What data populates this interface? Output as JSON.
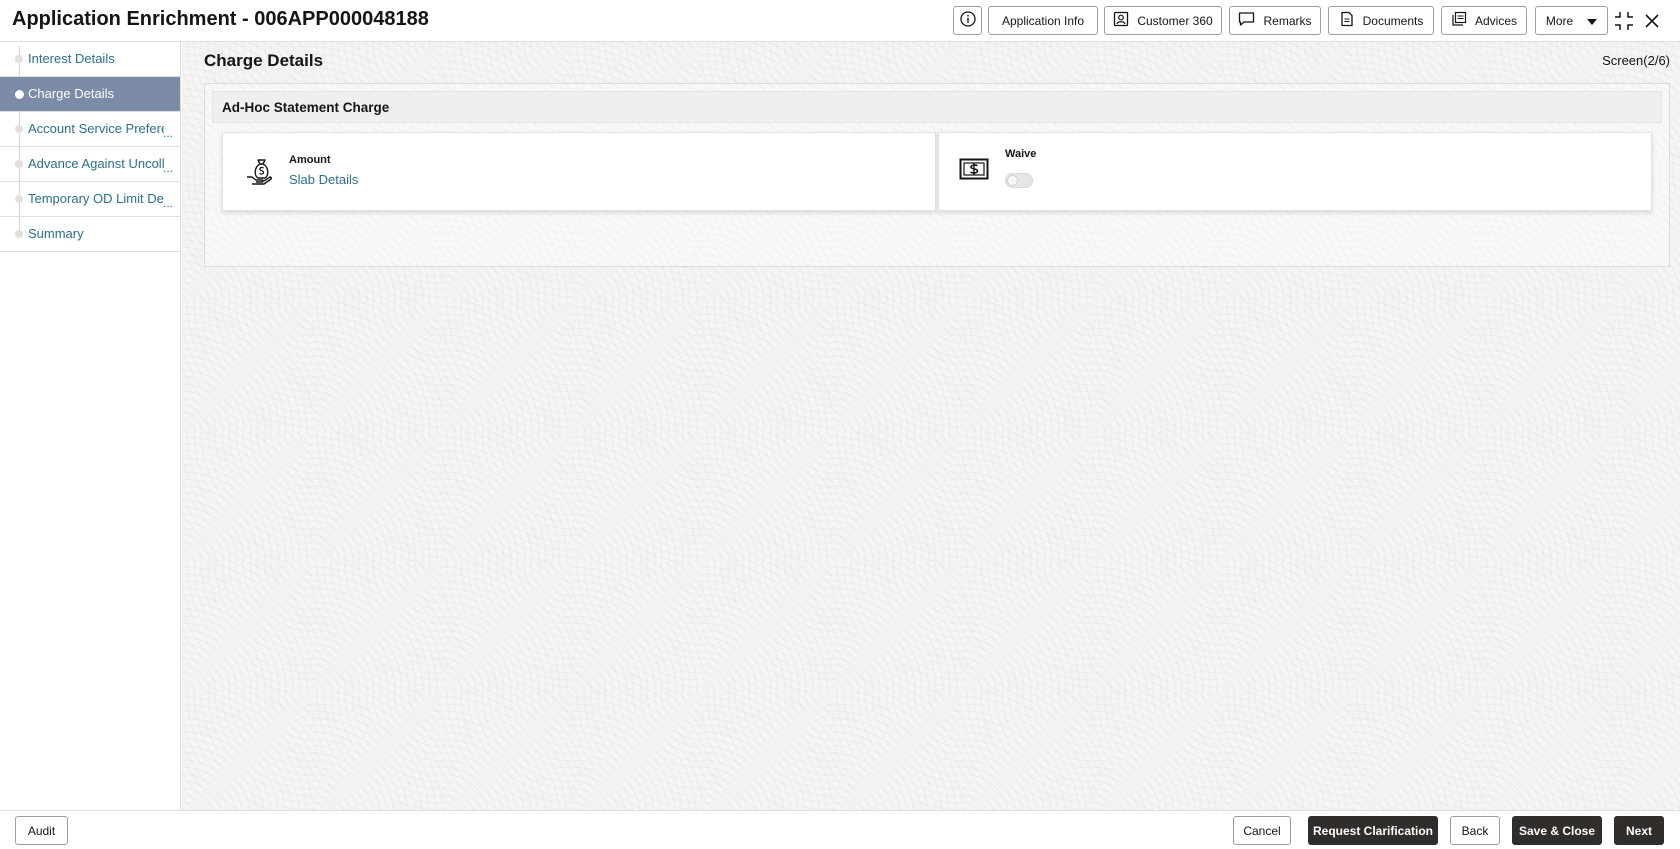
{
  "header": {
    "title": "Application Enrichment - 006APP000048188",
    "buttons": {
      "application_info": "Application Info",
      "customer_360": "Customer 360",
      "remarks": "Remarks",
      "documents": "Documents",
      "advices": "Advices",
      "more": "More"
    },
    "icons": [
      "info-icon",
      "person-card-icon",
      "speech-bubble-icon",
      "document-icon",
      "stacked-pages-icon",
      "caret-down-icon",
      "collapse-icon",
      "close-icon"
    ]
  },
  "sidebar": {
    "items": [
      {
        "label": "Interest Details",
        "active": false,
        "truncated": false
      },
      {
        "label": "Charge Details",
        "active": true,
        "truncated": false
      },
      {
        "label": "Account Service Prefere",
        "active": false,
        "truncated": true
      },
      {
        "label": "Advance Against Uncoll",
        "active": false,
        "truncated": true
      },
      {
        "label": "Temporary OD Limit De",
        "active": false,
        "truncated": true
      },
      {
        "label": "Summary",
        "active": false,
        "truncated": false
      }
    ],
    "ellipsis": "..."
  },
  "main": {
    "title": "Charge Details",
    "screen_indicator": "Screen(2/6)",
    "panel": {
      "title": "Ad-Hoc Statement Charge",
      "amount": {
        "label": "Amount",
        "link": "Slab Details",
        "icon": "money-bag-hand-icon"
      },
      "waive": {
        "label": "Waive",
        "toggle_on": false,
        "icon": "dollar-bill-icon"
      }
    }
  },
  "footer": {
    "audit": "Audit",
    "cancel": "Cancel",
    "request_clarification": "Request Clarification",
    "back": "Back",
    "save_close": "Save & Close",
    "next": "Next"
  },
  "colors": {
    "active_nav": "#7b8ba8",
    "link": "#2a6f8e",
    "primary_button": "#312d2a",
    "background": "#f4f4f3"
  }
}
